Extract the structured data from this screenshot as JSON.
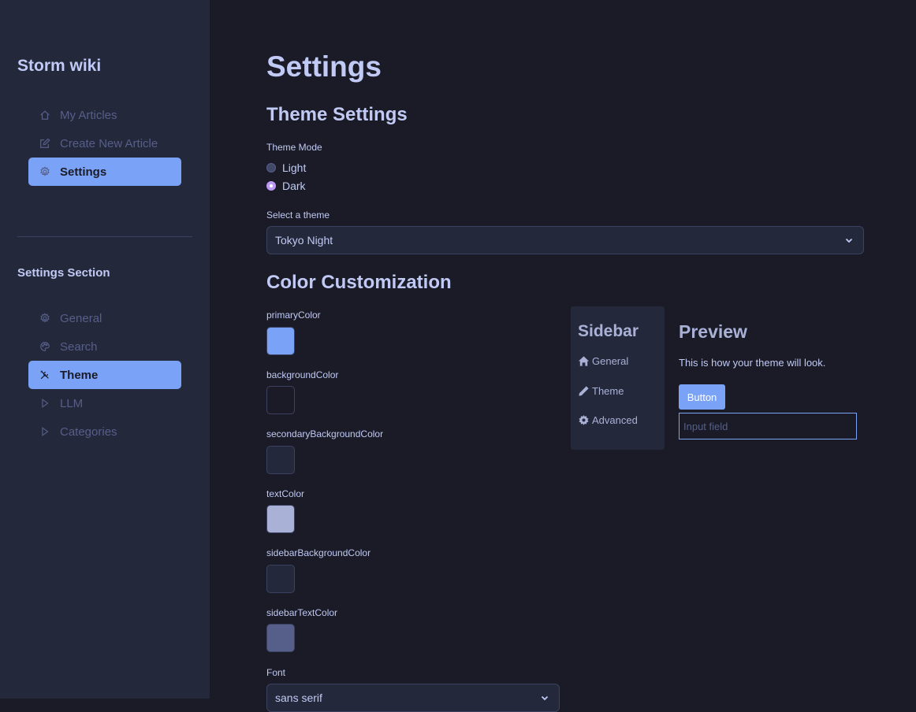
{
  "sidebar": {
    "app_title": "Storm wiki",
    "nav": [
      {
        "label": "My Articles",
        "icon": "house-icon"
      },
      {
        "label": "Create New Article",
        "icon": "edit-icon"
      },
      {
        "label": "Settings",
        "icon": "gear-icon",
        "active": true
      }
    ],
    "section_title": "Settings Section",
    "settings_nav": [
      {
        "label": "General",
        "icon": "gear-icon"
      },
      {
        "label": "Search",
        "icon": "palette-icon"
      },
      {
        "label": "Theme",
        "icon": "tools-icon",
        "active": true
      },
      {
        "label": "LLM",
        "icon": "play-icon"
      },
      {
        "label": "Categories",
        "icon": "play-icon"
      }
    ]
  },
  "main": {
    "title": "Settings",
    "theme_settings": {
      "heading": "Theme Settings",
      "mode_label": "Theme Mode",
      "modes": [
        {
          "label": "Light",
          "checked": false
        },
        {
          "label": "Dark",
          "checked": true
        }
      ],
      "select_label": "Select a theme",
      "selected_theme": "Tokyo Night"
    },
    "color_customization": {
      "heading": "Color Customization",
      "colors": [
        {
          "label": "primaryColor",
          "value": "#7aa2f7"
        },
        {
          "label": "backgroundColor",
          "value": "#1a1b26"
        },
        {
          "label": "secondaryBackgroundColor",
          "value": "#24283b"
        },
        {
          "label": "textColor",
          "value": "#a9b1d6"
        },
        {
          "label": "sidebarBackgroundColor",
          "value": "#24283b"
        },
        {
          "label": "sidebarTextColor",
          "value": "#565f89"
        }
      ],
      "font_label": "Font",
      "font_value": "sans serif"
    },
    "preview": {
      "sidebar_title": "Sidebar",
      "sidebar_items": [
        {
          "label": "General",
          "icon": "house-icon"
        },
        {
          "label": "Theme",
          "icon": "pencil-icon"
        },
        {
          "label": "Advanced",
          "icon": "gear-icon"
        }
      ],
      "title": "Preview",
      "text": "This is how your theme will look.",
      "button_label": "Button",
      "input_placeholder": "Input field"
    }
  },
  "colors": {
    "accent": "#7aa2f7",
    "background": "#1a1b26",
    "sidebar_bg": "#24283b",
    "radio_checked": "#bb9af7"
  }
}
